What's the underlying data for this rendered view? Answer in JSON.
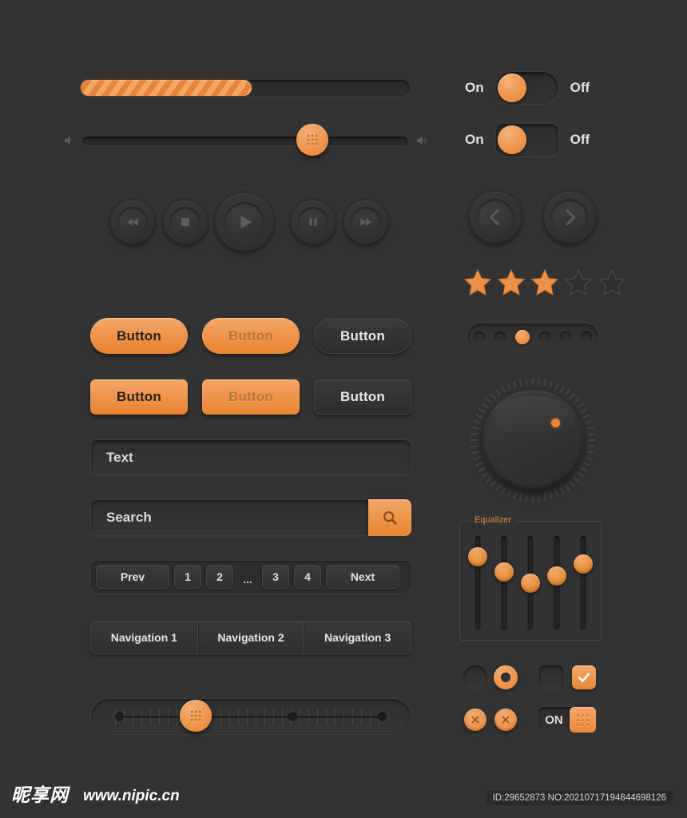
{
  "theme": {
    "background": "#333333",
    "accent": "#e8873a",
    "accent_light": "#f3a96c",
    "text": "#e4e4e4",
    "surface": "#2d2d2d"
  },
  "progress": {
    "value_percent": 52,
    "name": "striped-progress-bar"
  },
  "volume_slider": {
    "value_percent": 72,
    "icon_left": "speaker-mute-icon",
    "icon_right": "speaker-volume-icon",
    "knob_icon": "grip-dots-icon"
  },
  "media_controls": [
    {
      "label": "Rewind",
      "icon": "rewind-icon",
      "size": "small"
    },
    {
      "label": "Stop",
      "icon": "stop-icon",
      "size": "small"
    },
    {
      "label": "Play",
      "icon": "play-icon",
      "size": "large"
    },
    {
      "label": "Pause",
      "icon": "pause-icon",
      "size": "small"
    },
    {
      "label": "Forward",
      "icon": "forward-icon",
      "size": "small"
    }
  ],
  "buttons": {
    "row1": [
      {
        "label": "Button",
        "style": "orange-pill"
      },
      {
        "label": "Button",
        "style": "orange-pill-dim"
      },
      {
        "label": "Button",
        "style": "dark-pill"
      }
    ],
    "row2": [
      {
        "label": "Button",
        "style": "orange-rect"
      },
      {
        "label": "Button",
        "style": "orange-rect-dim"
      },
      {
        "label": "Button",
        "style": "dark-rect"
      }
    ]
  },
  "text_input": {
    "value": "Text",
    "placeholder": "Text"
  },
  "search": {
    "value": "Search",
    "placeholder": "Search",
    "button_icon": "search-icon"
  },
  "pagination": {
    "prev_label": "Prev",
    "next_label": "Next",
    "pages": [
      "1",
      "2"
    ],
    "ellipsis": "...",
    "pages_after": [
      "3",
      "4"
    ]
  },
  "navigation": [
    {
      "label": "Navigation 1"
    },
    {
      "label": "Navigation 2"
    },
    {
      "label": "Navigation 3"
    }
  ],
  "ruler_slider": {
    "value_percent": 33,
    "markers_percent": [
      0,
      66,
      100
    ],
    "knob_icon": "grip-dots-icon"
  },
  "toggles": [
    {
      "on_label": "On",
      "off_label": "Off",
      "state": "on",
      "shape": "pill"
    },
    {
      "on_label": "On",
      "off_label": "Off",
      "state": "on",
      "shape": "rounded-rect"
    }
  ],
  "arrows": [
    {
      "label": "Previous",
      "icon": "chevron-left-icon"
    },
    {
      "label": "Next",
      "icon": "chevron-right-icon"
    }
  ],
  "rating": {
    "max": 5,
    "value": 3,
    "icon": "star-icon"
  },
  "dot_pagination": {
    "count": 6,
    "active_index": 2
  },
  "rotary_knob": {
    "indicator_angle_degrees": 45,
    "name": "rotary-volume-knob"
  },
  "equalizer": {
    "legend": "Equalizer",
    "bands": [
      {
        "value_percent": 78
      },
      {
        "value_percent": 62
      },
      {
        "value_percent": 50
      },
      {
        "value_percent": 58
      },
      {
        "value_percent": 70
      }
    ]
  },
  "selection_controls": {
    "radio_off": {
      "label": "Radio unchecked",
      "checked": false
    },
    "radio_on": {
      "label": "Radio checked",
      "checked": true
    },
    "checkbox_off": {
      "label": "Checkbox unchecked",
      "checked": false
    },
    "checkbox_on": {
      "label": "Checkbox checked",
      "checked": true,
      "icon": "check-icon"
    },
    "close_buttons": [
      {
        "label": "Close",
        "icon": "close-x-icon"
      },
      {
        "label": "Close",
        "icon": "close-x-icon"
      }
    ],
    "on_switch": {
      "label": "ON",
      "handle_icon": "grip-dots-icon"
    }
  },
  "footer": {
    "watermark_cn": "昵享网",
    "watermark_url": "www.nipic.cn",
    "id_tag": "ID:29652873 NO:20210717194844698126"
  }
}
